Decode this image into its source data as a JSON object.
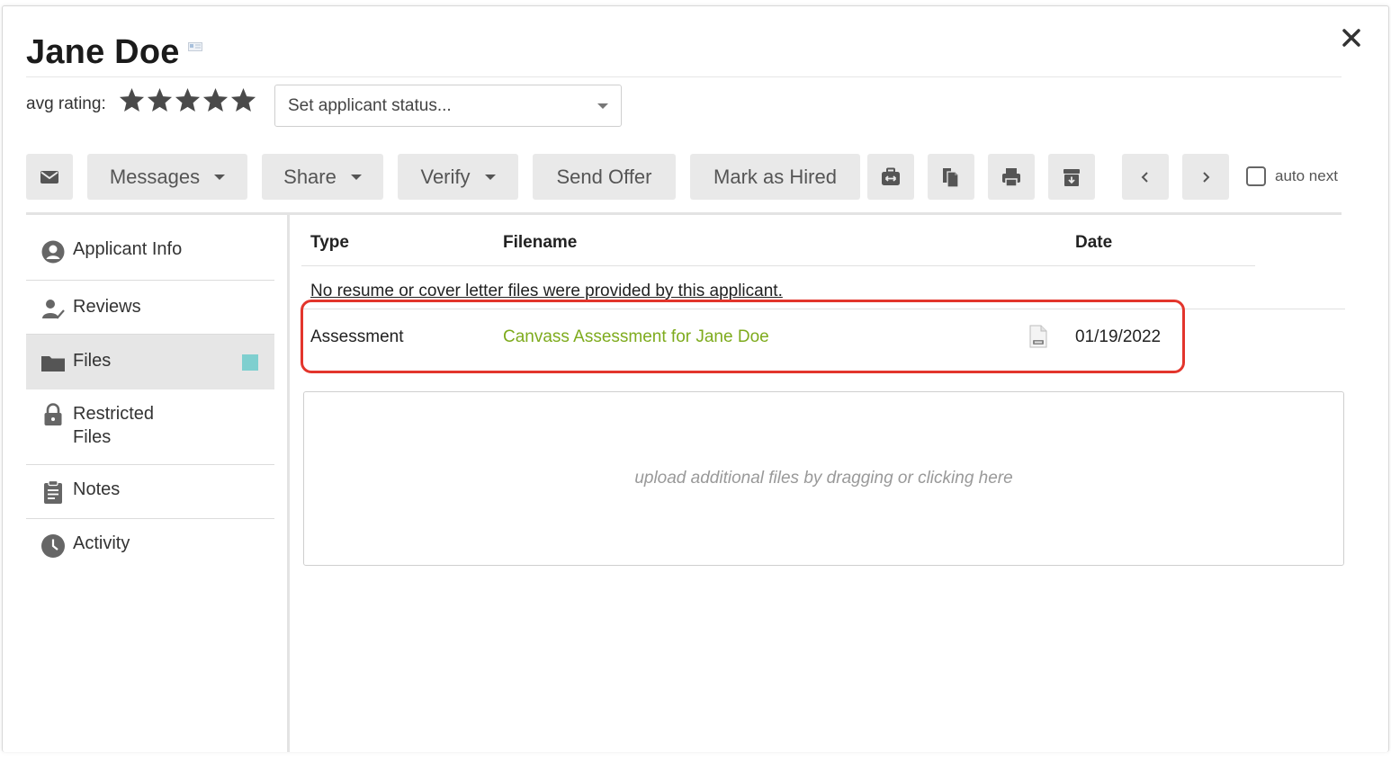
{
  "applicant": {
    "name": "Jane Doe",
    "avg_rating_label": "avg rating:",
    "stars": 5
  },
  "status_select": {
    "value": "Set applicant status..."
  },
  "toolbar": {
    "messages_label": "Messages",
    "share_label": "Share",
    "verify_label": "Verify",
    "send_offer_label": "Send Offer",
    "mark_hired_label": "Mark as Hired",
    "auto_next_label": "auto next"
  },
  "sidebar": {
    "items": [
      {
        "label": "Applicant Info",
        "icon": "user-circle-icon"
      },
      {
        "label": "Reviews",
        "icon": "user-check-icon"
      },
      {
        "label": "Files",
        "icon": "folder-icon",
        "active": true
      },
      {
        "label_line1": "Restricted",
        "label_line2": "Files",
        "icon": "lock-icon"
      },
      {
        "label": "Notes",
        "icon": "clipboard-icon"
      },
      {
        "label": "Activity",
        "icon": "clock-icon"
      }
    ]
  },
  "files_table": {
    "headers": {
      "type": "Type",
      "filename": "Filename",
      "date": "Date"
    },
    "no_files_message": "No resume or cover letter files were provided by this applicant.",
    "rows": [
      {
        "type": "Assessment",
        "filename": "Canvass Assessment for Jane Doe",
        "date": "01/19/2022"
      }
    ]
  },
  "dropzone": {
    "text": "upload additional files by dragging or clicking here"
  },
  "colors": {
    "link": "#7eab1d",
    "highlight": "#e3352c",
    "active_marker": "#7fcfcf"
  }
}
